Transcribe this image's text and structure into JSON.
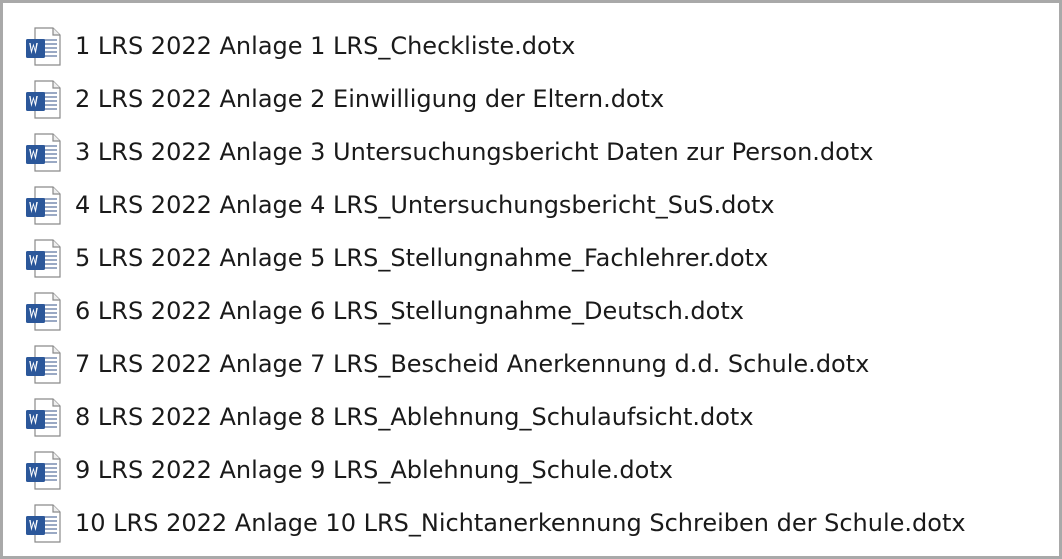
{
  "files": [
    {
      "name": "1 LRS 2022 Anlage 1 LRS_Checkliste.dotx",
      "icon": "word-template-icon"
    },
    {
      "name": "2 LRS 2022 Anlage 2 Einwilligung der Eltern.dotx",
      "icon": "word-template-icon"
    },
    {
      "name": "3 LRS 2022 Anlage 3 Untersuchungsbericht Daten zur Person.dotx",
      "icon": "word-template-icon"
    },
    {
      "name": "4 LRS 2022 Anlage 4 LRS_Untersuchungsbericht_SuS.dotx",
      "icon": "word-template-icon"
    },
    {
      "name": "5 LRS 2022 Anlage 5 LRS_Stellungnahme_Fachlehrer.dotx",
      "icon": "word-template-icon"
    },
    {
      "name": "6 LRS 2022 Anlage 6 LRS_Stellungnahme_Deutsch.dotx",
      "icon": "word-template-icon"
    },
    {
      "name": "7 LRS 2022 Anlage 7 LRS_Bescheid Anerkennung d.d. Schule.dotx",
      "icon": "word-template-icon"
    },
    {
      "name": "8 LRS 2022 Anlage 8 LRS_Ablehnung_Schulaufsicht.dotx",
      "icon": "word-template-icon"
    },
    {
      "name": "9 LRS 2022 Anlage 9 LRS_Ablehnung_Schule.dotx",
      "icon": "word-template-icon"
    },
    {
      "name": "10 LRS 2022 Anlage 10 LRS_Nichtanerkennung Schreiben der Schule.dotx",
      "icon": "word-template-icon"
    }
  ],
  "colors": {
    "word_blue": "#2b579a",
    "border": "#a9a9a9",
    "text": "#1a1a1a"
  }
}
